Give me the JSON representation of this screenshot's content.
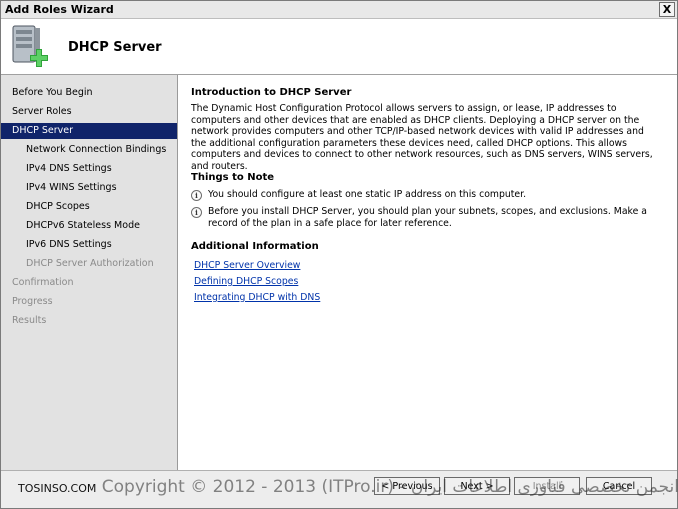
{
  "window": {
    "title": "Add Roles Wizard",
    "close_glyph": "X"
  },
  "header": {
    "title": "DHCP Server",
    "icon": "server-add-icon"
  },
  "sidebar": {
    "items": [
      {
        "label": "Before You Begin",
        "level": 1,
        "state": "normal"
      },
      {
        "label": "Server Roles",
        "level": 1,
        "state": "normal"
      },
      {
        "label": "DHCP Server",
        "level": 1,
        "state": "selected"
      },
      {
        "label": "Network Connection Bindings",
        "level": 2,
        "state": "normal"
      },
      {
        "label": "IPv4 DNS Settings",
        "level": 2,
        "state": "normal"
      },
      {
        "label": "IPv4 WINS Settings",
        "level": 2,
        "state": "normal"
      },
      {
        "label": "DHCP Scopes",
        "level": 2,
        "state": "normal"
      },
      {
        "label": "DHCPv6 Stateless Mode",
        "level": 2,
        "state": "normal"
      },
      {
        "label": "IPv6 DNS Settings",
        "level": 2,
        "state": "normal"
      },
      {
        "label": "DHCP Server Authorization",
        "level": 2,
        "state": "disabled"
      },
      {
        "label": "Confirmation",
        "level": 1,
        "state": "disabled"
      },
      {
        "label": "Progress",
        "level": 1,
        "state": "disabled"
      },
      {
        "label": "Results",
        "level": 1,
        "state": "disabled"
      }
    ]
  },
  "content": {
    "intro_heading": "Introduction to DHCP Server",
    "intro_text": "The Dynamic Host Configuration Protocol allows servers to assign, or lease, IP addresses to computers and other devices that are enabled as DHCP clients. Deploying a DHCP server on the network provides computers and other TCP/IP-based network devices with valid IP addresses and the additional configuration parameters these devices need, called DHCP options. This allows computers and devices to connect to other network resources, such as DNS servers, WINS servers, and routers.",
    "notes_heading": "Things to Note",
    "notes": [
      "You should configure at least one static IP address on this computer.",
      "Before you install DHCP Server, you should plan your subnets, scopes, and exclusions. Make a record of the plan in a safe place for later reference."
    ],
    "info_heading": "Additional Information",
    "links": [
      "DHCP Server Overview",
      "Defining DHCP Scopes",
      "Integrating DHCP with DNS"
    ]
  },
  "footer": {
    "previous_label": "< Previous",
    "next_label": "Next >",
    "install_label": "Install",
    "cancel_label": "Cancel"
  },
  "watermark": {
    "site": "TOSINSO.COM",
    "text": "Copyright © 2012 - 2013 (ITPro.ir) - انجمن تخصصی فناوری اطلاعات ایران"
  }
}
